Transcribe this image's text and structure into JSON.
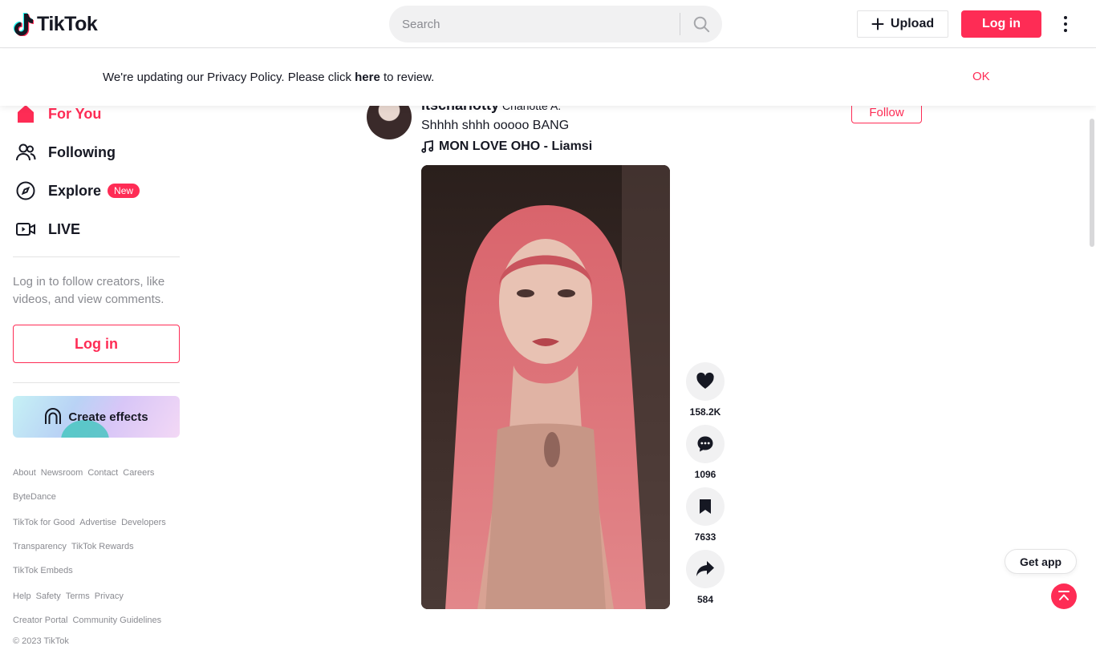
{
  "header": {
    "logo_text": "TikTok",
    "search_placeholder": "Search",
    "upload_label": "Upload",
    "login_label": "Log in"
  },
  "banner": {
    "text_before": "We're updating our Privacy Policy. Please click ",
    "link_text": "here",
    "text_after": " to review.",
    "ok_label": "OK"
  },
  "sidebar": {
    "nav": [
      {
        "label": "For You",
        "icon": "home-icon",
        "active": true
      },
      {
        "label": "Following",
        "icon": "people-icon"
      },
      {
        "label": "Explore",
        "icon": "compass-icon",
        "badge": "New"
      },
      {
        "label": "LIVE",
        "icon": "live-camera-icon"
      }
    ],
    "login_prompt": "Log in to follow creators, like videos, and view comments.",
    "login_label": "Log in",
    "effects_label": "Create effects",
    "footer": {
      "group1": [
        "About",
        "Newsroom",
        "Contact",
        "Careers",
        "ByteDance"
      ],
      "group2": [
        "TikTok for Good",
        "Advertise",
        "Developers",
        "Transparency",
        "TikTok Rewards",
        "TikTok Embeds"
      ],
      "group3": [
        "Help",
        "Safety",
        "Terms",
        "Privacy",
        "Creator Portal",
        "Community Guidelines"
      ],
      "copyright": "© 2023 TikTok"
    }
  },
  "post": {
    "author": "itscharlotty",
    "nickname": "Charlotte A.",
    "caption": "Shhhh shhh ooooo BANG",
    "music": "MON LOVE OHO - Liamsi",
    "follow_label": "Follow",
    "likes": "158.2K",
    "comments": "1096",
    "saves": "7633",
    "shares": "584"
  },
  "floating": {
    "get_app_label": "Get app"
  },
  "colors": {
    "accent": "#fe2c55",
    "text": "#161823",
    "muted": "#8a8b91"
  }
}
